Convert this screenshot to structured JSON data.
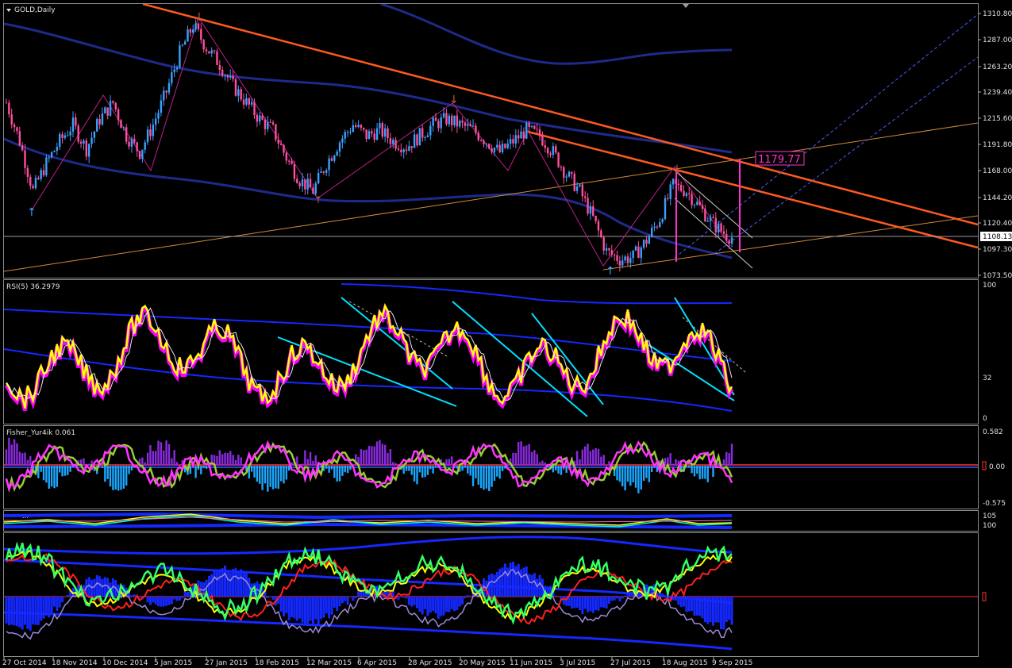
{
  "symbol_menu_icon": "triangle-down-icon",
  "main_title": "GOLD,Daily",
  "price_axis": [
    "1310.80",
    "1287.00",
    "1263.20",
    "1239.40",
    "1215.60",
    "1191.80",
    "1168.00",
    "1144.20",
    "1120.40",
    "1097.30",
    "1073.50"
  ],
  "price_range": [
    1073.5,
    1310.8
  ],
  "current_price": "1108.13",
  "target_label": "1179.77",
  "rsi": {
    "title": "RSI(5) 36.2979",
    "levels": [
      "100",
      "32",
      "0"
    ]
  },
  "fisher": {
    "title": "Fisher_Yur4ik 0.061",
    "levels": [
      "0.582",
      "0.00",
      "-0.575"
    ]
  },
  "mini": {
    "title": "...",
    "levels": [
      "105",
      "100"
    ]
  },
  "date_axis": [
    "27 Oct 2014",
    "18 Nov 2014",
    "10 Dec 2014",
    "5 Jan 2015",
    "27 Jan 2015",
    "18 Feb 2015",
    "12 Mar 2015",
    "6 Apr 2015",
    "28 Apr 2015",
    "20 May 2015",
    "11 Jun 2015",
    "3 Jul 2015",
    "27 Jul 2015",
    "18 Aug 2015",
    "9 Sep 2015"
  ],
  "colors": {
    "background": "#000000",
    "bull_candle": "#3aa0ff",
    "bear_candle": "#ff4fa0",
    "trendline": "#ff5a1f",
    "support_line": "#d08a3a",
    "ma_band": "#1e2a8a",
    "rsi_line": "#ffff00",
    "rsi_shadow": "#ff00ff",
    "trend_channel": "#00e0ff",
    "fisher_pos": "#1aa8ff",
    "fisher_neg": "#8a2be2",
    "fisher_line1": "#ff33ff",
    "fisher_line2": "#99cc33",
    "target_marker": "#ff33cc"
  },
  "chart_data": {
    "type": "candlestick",
    "title": "GOLD,Daily",
    "ylim": [
      1073.5,
      1310.8
    ],
    "close_path": [
      [
        0,
        1230
      ],
      [
        5,
        1195
      ],
      [
        10,
        1150
      ],
      [
        15,
        1175
      ],
      [
        20,
        1195
      ],
      [
        25,
        1210
      ],
      [
        30,
        1188
      ],
      [
        35,
        1215
      ],
      [
        40,
        1230
      ],
      [
        45,
        1200
      ],
      [
        50,
        1185
      ],
      [
        55,
        1210
      ],
      [
        60,
        1240
      ],
      [
        65,
        1275
      ],
      [
        70,
        1300
      ],
      [
        75,
        1280
      ],
      [
        80,
        1265
      ],
      [
        85,
        1245
      ],
      [
        90,
        1230
      ],
      [
        95,
        1215
      ],
      [
        100,
        1205
      ],
      [
        105,
        1180
      ],
      [
        110,
        1160
      ],
      [
        115,
        1150
      ],
      [
        120,
        1175
      ],
      [
        125,
        1195
      ],
      [
        130,
        1210
      ],
      [
        135,
        1200
      ],
      [
        140,
        1205
      ],
      [
        145,
        1195
      ],
      [
        150,
        1190
      ],
      [
        155,
        1200
      ],
      [
        160,
        1210
      ],
      [
        165,
        1215
      ],
      [
        170,
        1210
      ],
      [
        175,
        1205
      ],
      [
        180,
        1195
      ],
      [
        185,
        1185
      ],
      [
        190,
        1195
      ],
      [
        195,
        1205
      ],
      [
        200,
        1200
      ],
      [
        205,
        1185
      ],
      [
        210,
        1165
      ],
      [
        215,
        1150
      ],
      [
        220,
        1125
      ],
      [
        225,
        1095
      ],
      [
        230,
        1088
      ],
      [
        235,
        1090
      ],
      [
        240,
        1105
      ],
      [
        245,
        1125
      ],
      [
        250,
        1155
      ],
      [
        255,
        1150
      ],
      [
        260,
        1135
      ],
      [
        265,
        1120
      ],
      [
        270,
        1110
      ],
      [
        272,
        1108
      ]
    ]
  }
}
